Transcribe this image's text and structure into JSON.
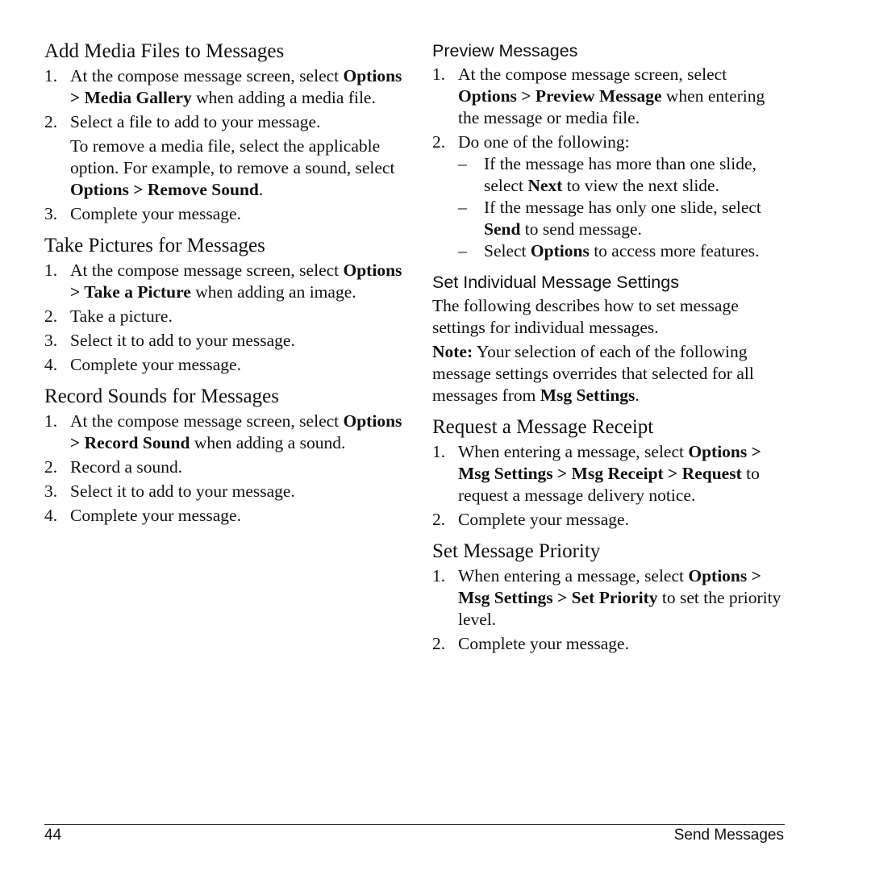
{
  "left_column": {
    "sections": [
      {
        "title": "Add Media Files to Messages",
        "heading_style": "serif",
        "steps": [
          {
            "num": "1.",
            "text": [
              {
                "t": "At the compose message screen, select "
              },
              {
                "t": "Options > Media Gallery",
                "b": true
              },
              {
                "t": " when adding a media file."
              }
            ]
          },
          {
            "num": "2.",
            "text": [
              {
                "t": "Select a file to add to your message."
              }
            ],
            "extra": [
              {
                "t": "To remove a media file, select the applicable option. For example, to remove a sound, select "
              },
              {
                "t": "Options > Remove Sound",
                "b": true
              },
              {
                "t": "."
              }
            ]
          },
          {
            "num": "3.",
            "text": [
              {
                "t": "Complete your message."
              }
            ]
          }
        ]
      },
      {
        "title": "Take Pictures for Messages",
        "heading_style": "serif",
        "steps": [
          {
            "num": "1.",
            "text": [
              {
                "t": "At the compose message screen, select "
              },
              {
                "t": "Options > Take a Picture",
                "b": true
              },
              {
                "t": " when adding an image."
              }
            ]
          },
          {
            "num": "2.",
            "text": [
              {
                "t": "Take a picture."
              }
            ]
          },
          {
            "num": "3.",
            "text": [
              {
                "t": "Select it to add to your message."
              }
            ]
          },
          {
            "num": "4.",
            "text": [
              {
                "t": "Complete your message."
              }
            ]
          }
        ]
      },
      {
        "title": "Record Sounds for Messages",
        "heading_style": "serif",
        "steps": [
          {
            "num": "1.",
            "text": [
              {
                "t": "At the compose message screen, select "
              },
              {
                "t": "Options > Record Sound",
                "b": true
              },
              {
                "t": " when adding a sound."
              }
            ]
          },
          {
            "num": "2.",
            "text": [
              {
                "t": "Record a sound."
              }
            ]
          },
          {
            "num": "3.",
            "text": [
              {
                "t": "Select it to add to your message."
              }
            ]
          },
          {
            "num": "4.",
            "text": [
              {
                "t": "Complete your message."
              }
            ]
          }
        ]
      }
    ]
  },
  "right_column": {
    "sections": [
      {
        "title": "Preview Messages",
        "heading_style": "sans",
        "steps": [
          {
            "num": "1.",
            "text": [
              {
                "t": "At the compose message screen, select "
              },
              {
                "t": "Options > Preview Message",
                "b": true
              },
              {
                "t": " when entering the message or media file."
              }
            ]
          },
          {
            "num": "2.",
            "text": [
              {
                "t": "Do one of the following:"
              }
            ],
            "bullets": [
              {
                "dash": "–",
                "text": [
                  {
                    "t": "If the message has more than one slide, select "
                  },
                  {
                    "t": "Next",
                    "b": true
                  },
                  {
                    "t": " to view the next slide."
                  }
                ]
              },
              {
                "dash": "–",
                "text": [
                  {
                    "t": "If the message has only one slide, select "
                  },
                  {
                    "t": "Send",
                    "b": true
                  },
                  {
                    "t": " to send message."
                  }
                ]
              },
              {
                "dash": "–",
                "text": [
                  {
                    "t": "Select "
                  },
                  {
                    "t": "Options",
                    "b": true
                  },
                  {
                    "t": " to access more features."
                  }
                ]
              }
            ]
          }
        ]
      },
      {
        "title": "Set Individual Message Settings",
        "heading_style": "sans",
        "paragraphs": [
          [
            {
              "t": "The following describes how to set message settings for individual messages."
            }
          ],
          [
            {
              "t": "Note:",
              "b": true
            },
            {
              "t": " Your selection of each of the following message settings overrides that selected for all messages from "
            },
            {
              "t": "Msg Settings",
              "b": true
            },
            {
              "t": "."
            }
          ]
        ]
      },
      {
        "title": "Request a Message Receipt",
        "heading_style": "serif",
        "steps": [
          {
            "num": "1.",
            "text": [
              {
                "t": "When entering a message, select "
              },
              {
                "t": "Options > Msg Settings > Msg Receipt > Request",
                "b": true
              },
              {
                "t": " to request a message delivery notice."
              }
            ]
          },
          {
            "num": "2.",
            "text": [
              {
                "t": "Complete your message."
              }
            ]
          }
        ]
      },
      {
        "title": "Set Message Priority",
        "heading_style": "serif",
        "steps": [
          {
            "num": "1.",
            "text": [
              {
                "t": "When entering a message, select "
              },
              {
                "t": "Options > Msg Settings > Set Priority",
                "b": true
              },
              {
                "t": " to set the priority level."
              }
            ]
          },
          {
            "num": "2.",
            "text": [
              {
                "t": "Complete your message."
              }
            ]
          }
        ]
      }
    ]
  },
  "footer": {
    "page_number": "44",
    "chapter_title": "Send Messages"
  }
}
